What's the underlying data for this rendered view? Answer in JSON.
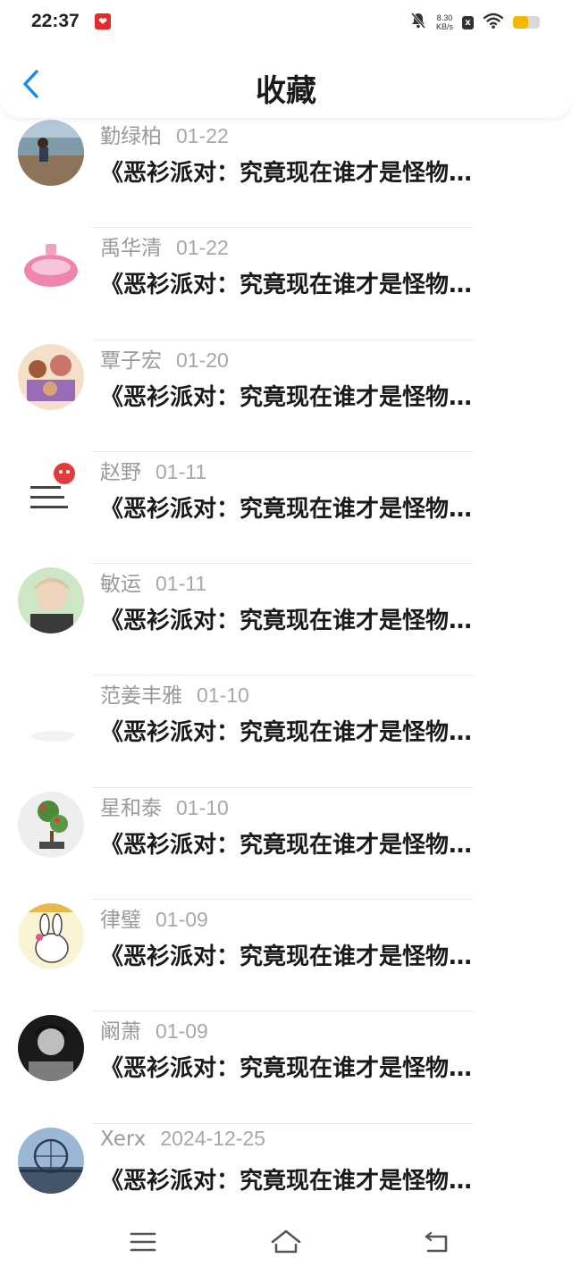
{
  "status_bar": {
    "time": "22:37",
    "app_icon": "heart-app-icon",
    "speed_value": "8.30",
    "speed_unit": "KB/s",
    "x_badge": "x",
    "battery_level": 0.55,
    "battery_color": "#f5b800"
  },
  "header": {
    "title": "收藏",
    "back_icon": "chevron-left-icon",
    "accent_color": "#1e88e5"
  },
  "items": [
    {
      "name": "勤绿柏",
      "date": "01-22",
      "title": "《恶衫派对：究竟现在谁才是怪物…"
    },
    {
      "name": "禹华清",
      "date": "01-22",
      "title": "《恶衫派对：究竟现在谁才是怪物…"
    },
    {
      "name": "覃子宏",
      "date": "01-20",
      "title": "《恶衫派对：究竟现在谁才是怪物…"
    },
    {
      "name": "赵野",
      "date": "01-11",
      "title": "《恶衫派对：究竟现在谁才是怪物…"
    },
    {
      "name": "敏运",
      "date": "01-11",
      "title": "《恶衫派对：究竟现在谁才是怪物…"
    },
    {
      "name": "范姜丰雅",
      "date": "01-10",
      "title": "《恶衫派对：究竟现在谁才是怪物…"
    },
    {
      "name": "星和泰",
      "date": "01-10",
      "title": "《恶衫派对：究竟现在谁才是怪物…"
    },
    {
      "name": "律璧",
      "date": "01-09",
      "title": "《恶衫派对：究竟现在谁才是怪物…"
    },
    {
      "name": "阚萧",
      "date": "01-09",
      "title": "《恶衫派对：究竟现在谁才是怪物…"
    },
    {
      "name": "Xerx",
      "date": "2024-12-25",
      "title": "《恶衫派对：究竟现在谁才是怪物…"
    }
  ],
  "nav": {
    "menu_icon": "menu-icon",
    "home_icon": "home-icon",
    "back_icon": "back-icon"
  }
}
